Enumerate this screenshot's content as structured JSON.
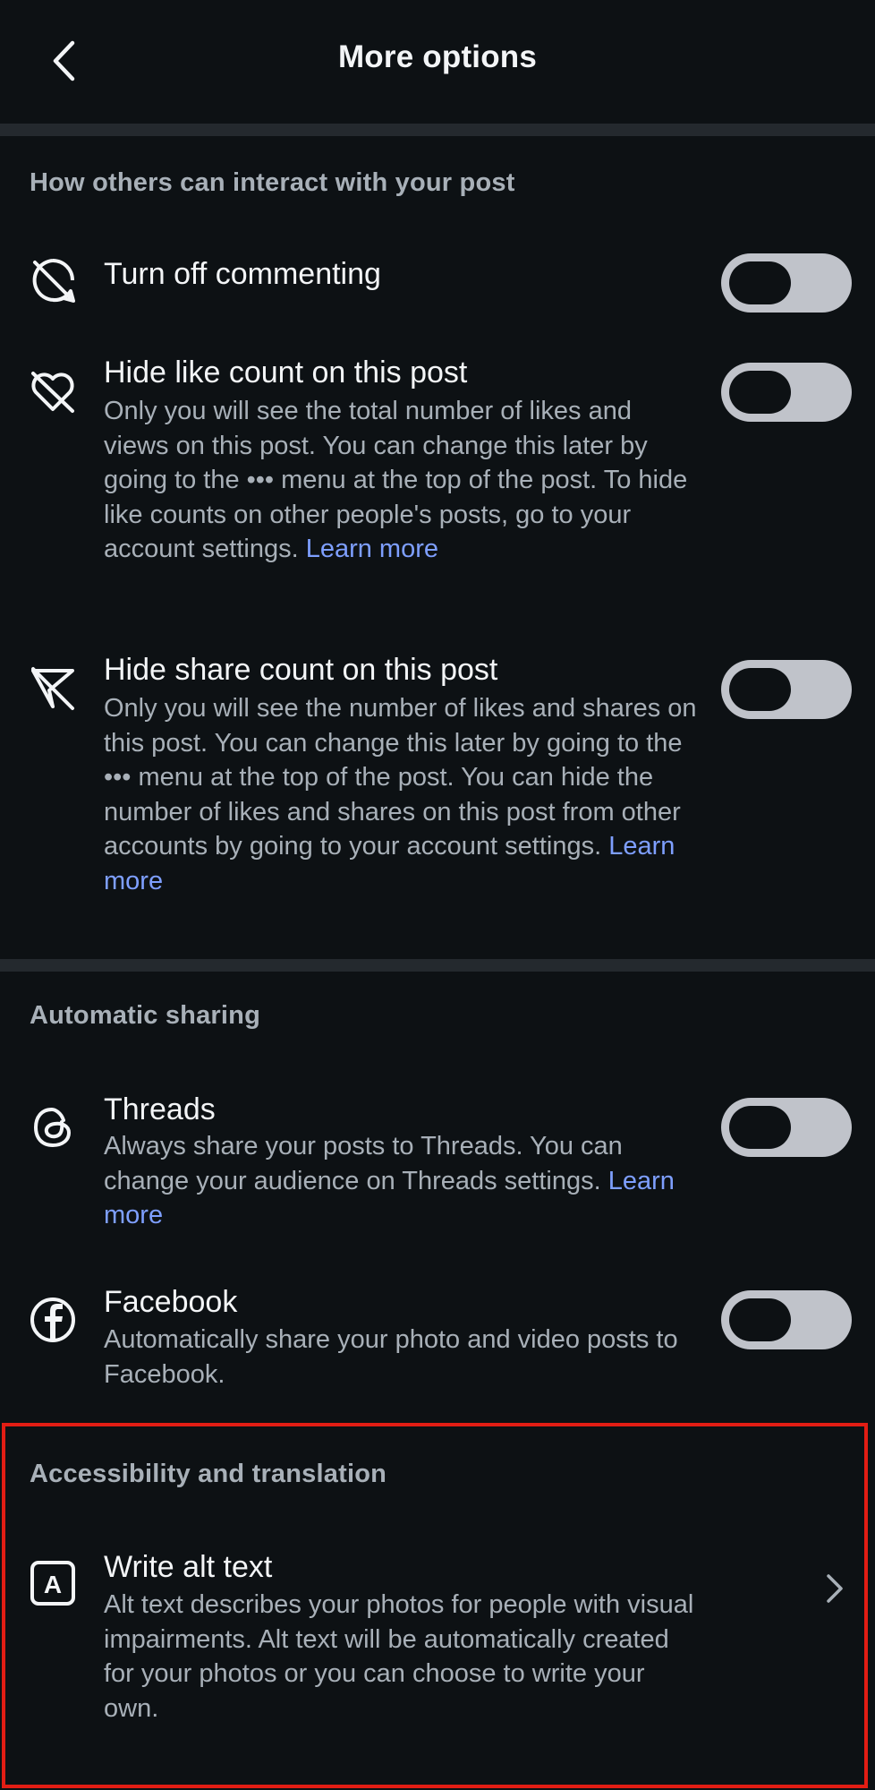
{
  "header": {
    "title": "More options"
  },
  "sections": {
    "interact": {
      "title": "How others can interact with your post",
      "commenting": {
        "title": "Turn off commenting",
        "enabled": false
      },
      "like_count": {
        "title": "Hide like count on this post",
        "desc_before": "Only you will see the total number of likes and views on this post. You can change this later by going to the ••• menu at the top of the post. To hide like counts on other people's posts, go to your account settings. ",
        "link": "Learn more",
        "enabled": false
      },
      "share_count": {
        "title": "Hide share count on this post",
        "desc_before": "Only you will see the number of likes and shares on this post. You can change this later by going to the ••• menu at the top of the post. You can hide the number of likes and shares on this post from other accounts by going to your account settings. ",
        "link": "Learn more",
        "enabled": false
      }
    },
    "sharing": {
      "title": "Automatic sharing",
      "threads": {
        "title": "Threads",
        "desc_before": "Always share your posts to Threads. You can change your audience on Threads settings. ",
        "link": "Learn more",
        "enabled": false
      },
      "facebook": {
        "title": "Facebook",
        "desc_before": "Automatically share your photo and video posts to Facebook.",
        "enabled": false
      }
    },
    "accessibility": {
      "title": "Accessibility and translation",
      "alt_text": {
        "title": "Write alt text",
        "desc_before": "Alt text describes your photos for people with visual impairments. Alt text will be automatically created for your photos or you can choose to write your own."
      }
    }
  },
  "colors": {
    "background": "#0d1114",
    "divider": "#24292e",
    "primary_text": "#f3f5f7",
    "secondary_text": "#a8b0b8",
    "link": "#7e9fff",
    "toggle_track": "#c0c3ca",
    "highlight": "#e21d14"
  },
  "icons": {
    "back": "chevron-left-icon",
    "commenting": "comment-off-icon",
    "like_count": "heart-off-icon",
    "share_count": "share-off-icon",
    "threads": "threads-icon",
    "facebook": "facebook-icon",
    "alt_text": "alt-text-icon",
    "open": "chevron-right-icon"
  }
}
